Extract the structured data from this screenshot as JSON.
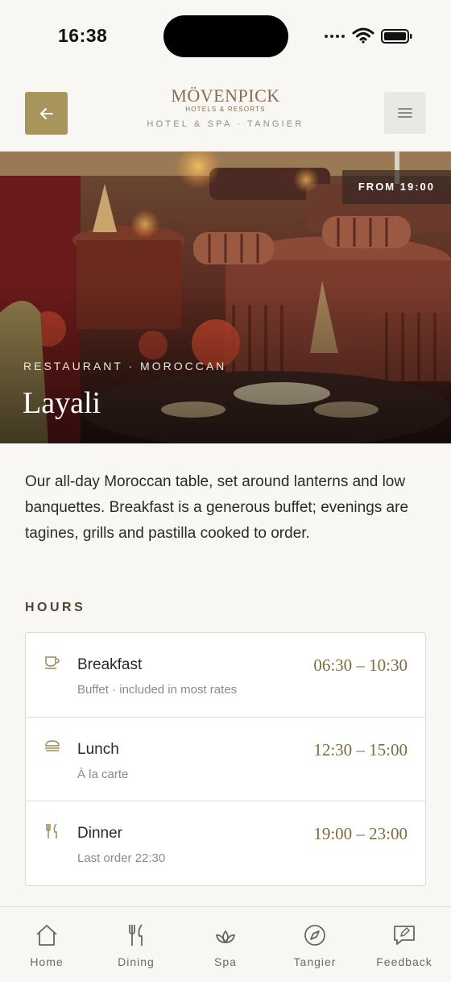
{
  "status_bar": {
    "time": "16:38"
  },
  "header": {
    "back_icon": "arrow-left-icon",
    "brand": "MÖVENPICK",
    "brand_sub": "HOTELS & RESORTS",
    "hotel_line": "HOTEL & SPA · TANGIER",
    "menu_icon": "hamburger-icon"
  },
  "hero": {
    "badge": "FROM 19:00",
    "eyebrow": "RESTAURANT · MOROCCAN",
    "title": "Layali"
  },
  "intro": "Our all-day Moroccan table, set around lanterns and low banquettes. Breakfast is a generous buffet; evenings are tagines, grills and pastilla cooked to order.",
  "hours": {
    "title": "HOURS",
    "rows": [
      {
        "icon": "coffee-cup-icon",
        "name": "Breakfast",
        "sub": "Buffet · included in most rates",
        "time": "06:30 – 10:30"
      },
      {
        "icon": "burger-icon",
        "name": "Lunch",
        "sub": "À la carte",
        "time": "12:30 – 15:00"
      },
      {
        "icon": "fork-knife-icon",
        "name": "Dinner",
        "sub": "Last order 22:30",
        "time": "19:00 – 23:00"
      }
    ]
  },
  "tabs": [
    {
      "icon": "home-icon",
      "label": "Home"
    },
    {
      "icon": "fork-knife-icon",
      "label": "Dining"
    },
    {
      "icon": "lotus-icon",
      "label": "Spa"
    },
    {
      "icon": "compass-icon",
      "label": "Tangier"
    },
    {
      "icon": "feedback-icon",
      "label": "Feedback"
    }
  ],
  "colors": {
    "accent": "#a8955c",
    "gold_text": "#7d6c3e",
    "background": "#f8f7f3"
  }
}
